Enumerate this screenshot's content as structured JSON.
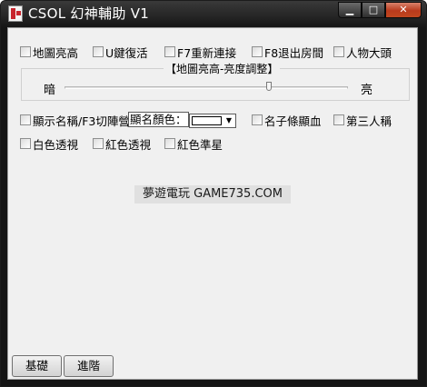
{
  "window": {
    "title": "CSOL 幻神輔助 V1",
    "controls": {
      "minimize": "▁",
      "maximize": "□",
      "close": "✕"
    }
  },
  "checkboxes_row1": [
    {
      "label": "地圖亮高",
      "checked": false
    },
    {
      "label": "U鍵復活",
      "checked": false
    },
    {
      "label": "F7重新連接",
      "checked": false
    },
    {
      "label": "F8退出房間",
      "checked": false
    },
    {
      "label": "人物大頭",
      "checked": false
    }
  ],
  "brightness_group": {
    "title": "【地圖亮高-亮度調整】",
    "min_label": "暗",
    "max_label": "亮",
    "value_fraction": 0.72
  },
  "checkboxes_row2": [
    {
      "label": "顯示名稱/F3切陣營",
      "checked": false
    },
    {
      "label": "名子條顯血",
      "checked": false
    },
    {
      "label": "第三人稱",
      "checked": false
    }
  ],
  "name_color": {
    "label": "顯名顏色：",
    "selected_color": "#ffffff",
    "arrow_icon": "chevron-down-icon"
  },
  "checkboxes_row3": [
    {
      "label": "白色透視",
      "checked": false
    },
    {
      "label": "紅色透視",
      "checked": false
    },
    {
      "label": "紅色準星",
      "checked": false
    }
  ],
  "watermark": "夢遊電玩 GAME735.COM",
  "bottom_buttons": [
    {
      "label": "基礎"
    },
    {
      "label": "進階"
    }
  ]
}
